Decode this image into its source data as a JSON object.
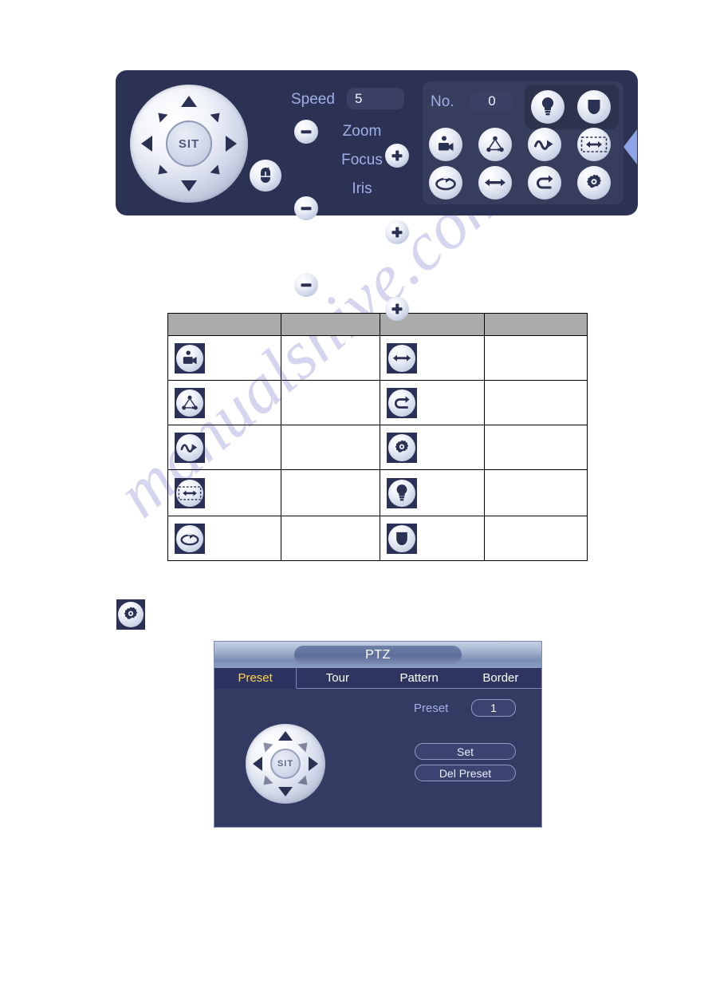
{
  "page": {
    "watermark": "manualshive.com",
    "background_color": "#ffffff"
  },
  "colors": {
    "panel_bg": "#2c3253",
    "dialog_bg": "#333b63",
    "accent_label": "#9fb0e8",
    "active_tab": "#ffd24d",
    "table_header": "#ababab",
    "collapse_arrow": "#8ea4e8"
  },
  "ptz_toolbar": {
    "name": "PTZ control panel",
    "joystick": {
      "center_label": "SIT",
      "directions": [
        "up",
        "up-right",
        "right",
        "down-right",
        "down",
        "down-left",
        "left",
        "up-left"
      ]
    },
    "mouse_button_icon": "mouse-icon",
    "speed": {
      "label": "Speed",
      "value": "5"
    },
    "adjusters": [
      {
        "label": "Zoom",
        "minus": "−",
        "plus": "+"
      },
      {
        "label": "Focus",
        "minus": "−",
        "plus": "+"
      },
      {
        "label": "Iris",
        "minus": "−",
        "plus": "+"
      }
    ],
    "number": {
      "label": "No.",
      "value": "0"
    },
    "lamp_group": [
      {
        "icon": "light-bulb-icon"
      },
      {
        "icon": "wiper-icon"
      }
    ],
    "function_icons": [
      {
        "icon": "preset-camera-icon"
      },
      {
        "icon": "tour-icon"
      },
      {
        "icon": "pattern-icon"
      },
      {
        "icon": "scan-border-icon"
      },
      {
        "icon": "rotate-icon"
      },
      {
        "icon": "auto-pan-icon"
      },
      {
        "icon": "flip-icon"
      },
      {
        "icon": "gear-icon"
      }
    ],
    "collapse_arrow_icon": "chevron-left-icon"
  },
  "icon_table": {
    "headers": [
      "",
      "",
      "",
      ""
    ],
    "rows": [
      {
        "icon_left": "preset-camera-icon",
        "desc_left": "",
        "icon_right": "auto-pan-icon",
        "desc_right": ""
      },
      {
        "icon_left": "tour-icon",
        "desc_left": "",
        "icon_right": "flip-icon",
        "desc_right": ""
      },
      {
        "icon_left": "pattern-icon",
        "desc_left": "",
        "icon_right": "gear-icon",
        "desc_right": ""
      },
      {
        "icon_left": "scan-border-icon",
        "desc_left": "",
        "icon_right": "light-bulb-icon",
        "desc_right": ""
      },
      {
        "icon_left": "rotate-icon",
        "desc_left": "",
        "icon_right": "wiper-icon",
        "desc_right": ""
      }
    ]
  },
  "standalone_gear": {
    "icon": "gear-icon"
  },
  "ptz_dialog": {
    "title": "PTZ",
    "tabs": [
      {
        "label": "Preset",
        "active": true
      },
      {
        "label": "Tour",
        "active": false
      },
      {
        "label": "Pattern",
        "active": false
      },
      {
        "label": "Border",
        "active": false
      }
    ],
    "preset": {
      "label": "Preset",
      "value": "1"
    },
    "buttons": [
      {
        "label": "Set"
      },
      {
        "label": "Del Preset"
      }
    ],
    "joystick": {
      "center_label": "SIT"
    }
  }
}
